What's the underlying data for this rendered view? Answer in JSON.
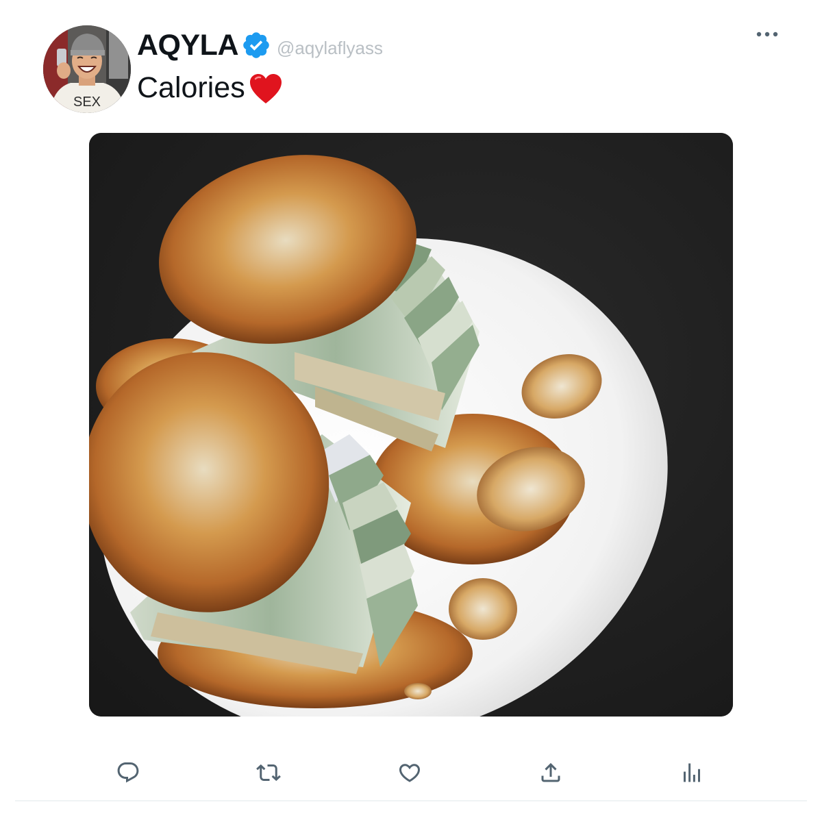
{
  "author": {
    "display_name": "AQYLA",
    "handle": "@aqylaflyass",
    "verified": true,
    "avatar_shirt_text": "SEX"
  },
  "tweet": {
    "text": "Calories",
    "emoji_icon": "red-heart-emoji"
  },
  "media": {
    "icon": "photo-media"
  },
  "actions": {
    "reply_icon": "reply-icon",
    "retweet_icon": "retweet-icon",
    "like_icon": "like-icon",
    "share_icon": "share-icon",
    "views_icon": "views-icon"
  },
  "colors": {
    "verified_blue": "#1d9bf0",
    "text_primary": "#0f1419",
    "text_secondary": "#b9bfc4",
    "icon_gray": "#536471",
    "heart_red": "#e0141e"
  }
}
